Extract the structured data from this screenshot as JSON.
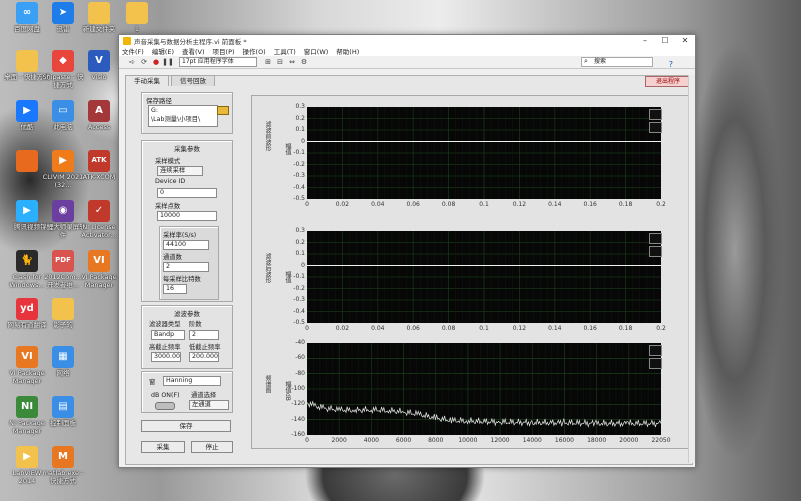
{
  "desktop": {
    "icons": [
      {
        "label": "百度网盘",
        "color": "#3aa0f5",
        "glyph": "∞"
      },
      {
        "label": "迅雷",
        "color": "#1e7de8",
        "glyph": "➤"
      },
      {
        "label": "新建文件夹",
        "color": "#f2c24c",
        "glyph": ""
      },
      {
        "label": "1",
        "color": "#f2c24c",
        "glyph": ""
      },
      {
        "label": "桌面 - 快捷方式",
        "color": "#f2c24c",
        "glyph": ""
      },
      {
        "label": "Snipaste - 快捷方式",
        "color": "#e8453c",
        "glyph": "◆"
      },
      {
        "label": "Visio",
        "color": "#2a5bbd",
        "glyph": "V"
      },
      {
        "label": "优酷",
        "color": "#1a78ff",
        "glyph": "▶"
      },
      {
        "label": "此电脑",
        "color": "#3a8ee6",
        "glyph": "▭"
      },
      {
        "label": "Access",
        "color": "#a4373a",
        "glyph": "A"
      },
      {
        "label": "",
        "color": "#e86a1e",
        "glyph": ""
      },
      {
        "label": "CLIVIM 2021 (32...",
        "color": "#f07b1a",
        "glyph": "▶"
      },
      {
        "label": "ATK-XCOM",
        "color": "#c0392b",
        "glyph": "ATK"
      },
      {
        "label": "腾讯视频",
        "color": "#2bb0ff",
        "glyph": "▶"
      },
      {
        "label": "锦鲤大师录屏软件",
        "color": "#6b3fa0",
        "glyph": "◉"
      },
      {
        "label": "NI License Activator...",
        "color": "#c0392b",
        "glyph": "✓"
      },
      {
        "label": "Clash for Windows...",
        "color": "#2a2a2a",
        "glyph": "🐈"
      },
      {
        "label": "2012Com... 开发者维...",
        "color": "#d9534f",
        "glyph": "PDF"
      },
      {
        "label": "VI Package Manager",
        "color": "#e87722",
        "glyph": "VI"
      },
      {
        "label": "网易有道翻译",
        "color": "#e8353d",
        "glyph": "yd"
      },
      {
        "label": "影子的",
        "color": "#f2c24c",
        "glyph": ""
      },
      {
        "label": "VI Package Manager",
        "color": "#e87722",
        "glyph": "VI"
      },
      {
        "label": "网络",
        "color": "#3a8ee6",
        "glyph": "▦"
      },
      {
        "label": "NI Package Manager",
        "color": "#3a8a3a",
        "glyph": "NI"
      },
      {
        "label": "控制面板",
        "color": "#3a8ee6",
        "glyph": "▤"
      },
      {
        "label": "LabVIEW 2014",
        "color": "#f2c24c",
        "glyph": "▶"
      },
      {
        "label": "matlab.exe - 快捷方式",
        "color": "#e87722",
        "glyph": "M"
      }
    ]
  },
  "window": {
    "title": "声音采集与数据分析主程序.vi 前面板 *",
    "menu": [
      "文件(F)",
      "编辑(E)",
      "查看(V)",
      "项目(P)",
      "操作(O)",
      "工具(T)",
      "窗口(W)",
      "帮助(H)"
    ],
    "toolbar": {
      "font": "17pt 应用程序字体",
      "search_placeholder": "搜索"
    },
    "exit_label": "退出程序",
    "tabs": [
      "手动采集",
      "信号回放"
    ]
  },
  "left": {
    "save_path": {
      "title": "保存路径",
      "value_line1": "G:",
      "value_line2": "\\Lab测量\\小项目\\"
    },
    "acq": {
      "title": "采集参数",
      "mode_label": "采样模式",
      "mode_value": "连续采样",
      "device_label": "Device ID",
      "device_value": "0",
      "samples_label": "采样点数",
      "samples_value": "10000",
      "rate_label": "采样率(S/s)",
      "rate_value": "44100",
      "channels_label": "通道数",
      "channels_value": "2",
      "bits_label": "每采样比特数",
      "bits_value": "16"
    },
    "filter": {
      "title": "滤波参数",
      "type_label": "滤波器类型",
      "type_value": "Bandp",
      "order_label": "阶数",
      "order_value": "2",
      "high_cut_label": "高截止频率",
      "high_cut_value": "3000.00",
      "low_cut_label": "低截止频率",
      "low_cut_value": "200.000",
      "window_label": "窗",
      "window_value": "Hanning",
      "db_label": "dB ON(F)",
      "channel_sel_label": "通道选择",
      "channel_sel_value": "左通道"
    },
    "save_btn": "保存",
    "start_btn": "采集",
    "stop_btn": "停止"
  },
  "graphs": {
    "g1": {
      "ylabel": "幅值",
      "side_label": "滤波前波形",
      "yticks": [
        "0.3",
        "0.2",
        "0.1",
        "0",
        "-0.1",
        "-0.2",
        "-0.3",
        "-0.4",
        "-0.5"
      ],
      "xticks": [
        "0",
        "0.02",
        "0.04",
        "0.06",
        "0.08",
        "0.1",
        "0.12",
        "0.14",
        "0.16",
        "0.18",
        "0.2"
      ]
    },
    "g2": {
      "ylabel": "幅值",
      "side_label": "滤波后波形",
      "yticks": [
        "0.3",
        "0.2",
        "0.1",
        "0",
        "-0.1",
        "-0.2",
        "-0.3",
        "-0.4",
        "-0.5"
      ],
      "xticks": [
        "0",
        "0.02",
        "0.04",
        "0.06",
        "0.08",
        "0.1",
        "0.12",
        "0.14",
        "0.16",
        "0.18",
        "0.2"
      ]
    },
    "g3": {
      "ylabel": "幅值dB",
      "side_label": "频谱图",
      "yticks": [
        "-40",
        "-60",
        "-80",
        "-100",
        "-120",
        "-140",
        "-160"
      ],
      "xticks": [
        "0",
        "2000",
        "4000",
        "6000",
        "8000",
        "10000",
        "12000",
        "14000",
        "16000",
        "18000",
        "20000",
        "22050"
      ]
    }
  },
  "chart_data": [
    {
      "type": "line",
      "title": "",
      "xlabel": "",
      "ylabel": "幅值",
      "xlim": [
        0,
        0.2
      ],
      "ylim": [
        -0.5,
        0.3
      ],
      "series": [
        {
          "values_description_note": null,
          "x": [
            0,
            0.2
          ],
          "y": [
            0,
            0
          ]
        }
      ],
      "grid": true
    },
    {
      "type": "line",
      "title": "",
      "xlabel": "",
      "ylabel": "幅值",
      "xlim": [
        0,
        0.2
      ],
      "ylim": [
        -0.5,
        0.3
      ],
      "series": [
        {
          "x": [
            0,
            0.2
          ],
          "y": [
            0,
            0
          ]
        }
      ],
      "grid": true
    },
    {
      "type": "line",
      "title": "",
      "xlabel": "",
      "ylabel": "幅值dB",
      "xlim": [
        0,
        22050
      ],
      "ylim": [
        -160,
        -40
      ],
      "series": [
        {
          "x": [
            0,
            500,
            1000,
            2000,
            3000,
            4000,
            5000,
            6000,
            7000,
            8000,
            9000,
            10000,
            12000,
            14000,
            16000,
            18000,
            20000,
            22050
          ],
          "y": [
            -118,
            -122,
            -125,
            -127,
            -128,
            -127,
            -128,
            -130,
            -133,
            -138,
            -141,
            -142,
            -143,
            -144,
            -144,
            -145,
            -145,
            -145
          ]
        }
      ],
      "grid": true
    }
  ]
}
